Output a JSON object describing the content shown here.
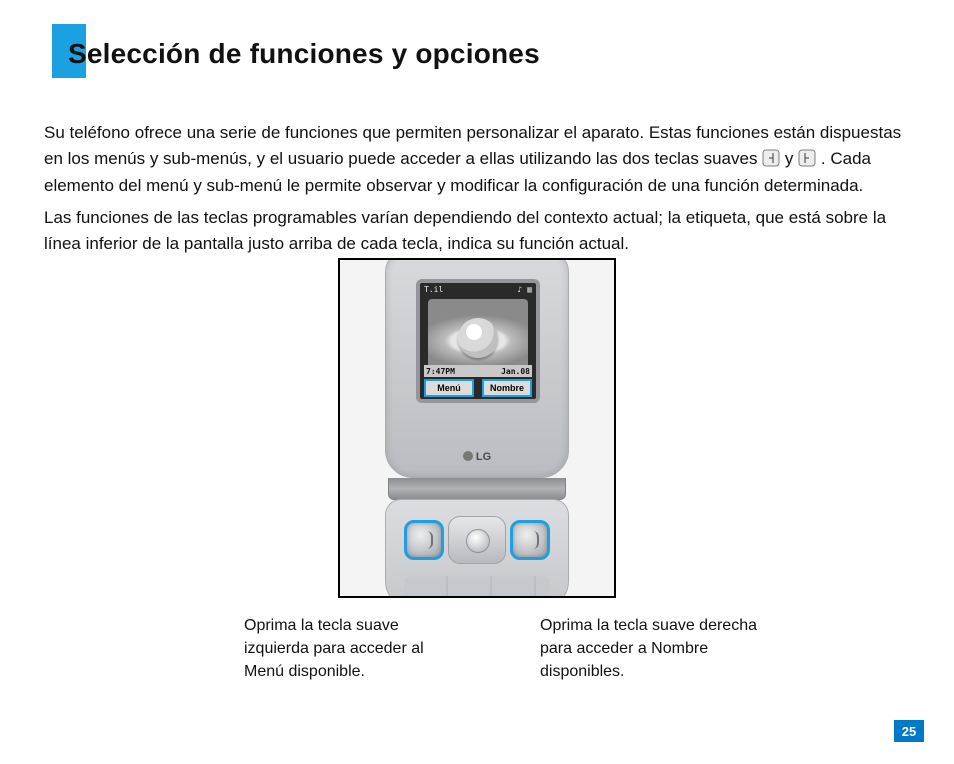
{
  "title": "Selección de funciones y opciones",
  "para1_a": "Su teléfono ofrece una serie de funciones que permiten personalizar el aparato. Estas funciones están dispuestas en los menús y sub-menús, y el usuario puede acceder a ellas utilizando las dos teclas suaves ",
  "para1_b": " y ",
  "para1_c": " . Cada elemento del menú y sub-menú le permite observar y modificar la configuración de una función determinada.",
  "para2": "Las funciones de las teclas programables varían dependiendo del contexto actual; la etiqueta, que está sobre la línea inferior de la pantalla justo arriba de cada tecla, indica su función actual.",
  "phone": {
    "status_left": "T.il",
    "status_right": "♪ ▥",
    "time": "7:47PM",
    "date": "Jan.08",
    "softkey_left": "Menú",
    "softkey_right": "Nombre",
    "brand": "LG"
  },
  "caption_left": "Oprima la tecla suave izquierda para acceder al Menú disponible.",
  "caption_right": "Oprima la tecla suave derecha para acceder a Nombre disponibles.",
  "page_number": "25"
}
